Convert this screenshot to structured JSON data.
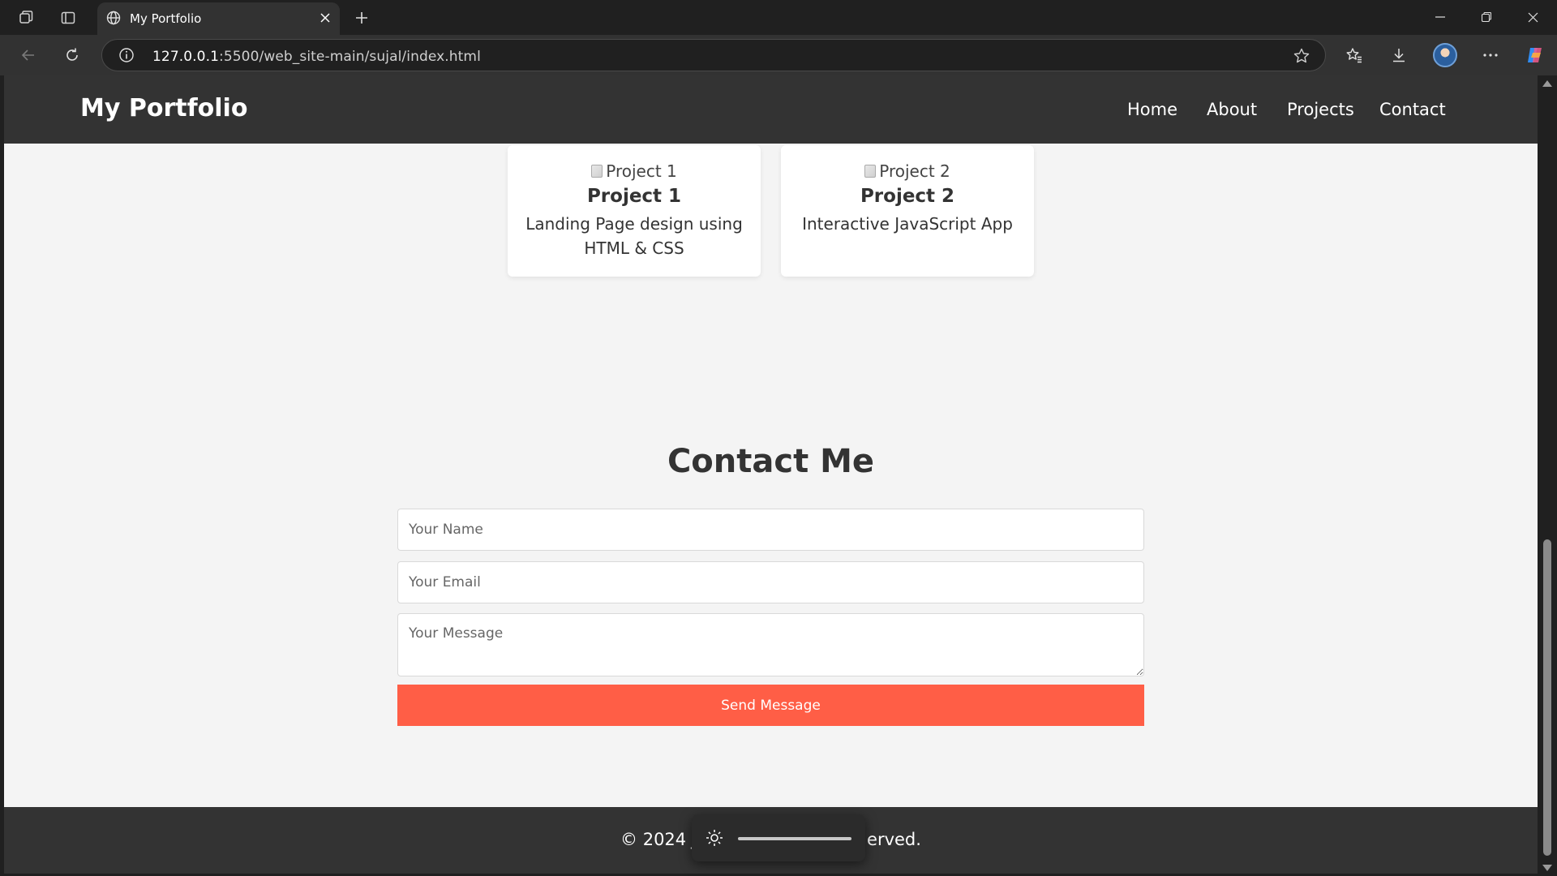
{
  "browser": {
    "tab_title": "My Portfolio",
    "url_host": "127.0.0.1",
    "url_rest": ":5500/web_site-main/sujal/index.html"
  },
  "site": {
    "logo": "My Portfolio",
    "nav": [
      "Home",
      "About",
      "Projects",
      "Contact"
    ]
  },
  "projects": [
    {
      "image_alt": "Project 1",
      "title": "Project 1",
      "description": "Landing Page design using HTML & CSS"
    },
    {
      "image_alt": "Project 2",
      "title": "Project 2",
      "description": "Interactive JavaScript App"
    }
  ],
  "contact": {
    "heading": "Contact Me",
    "name_placeholder": "Your Name",
    "email_placeholder": "Your Email",
    "message_placeholder": "Your Message",
    "submit_label": "Send Message"
  },
  "footer": {
    "visible_text_left": "© 2024 J",
    "visible_text_right": "erved."
  },
  "overlay": {
    "icon": "brightness-icon"
  },
  "colors": {
    "accent": "#ff5e46",
    "header_bg": "#333333",
    "page_bg": "#f4f4f4"
  }
}
